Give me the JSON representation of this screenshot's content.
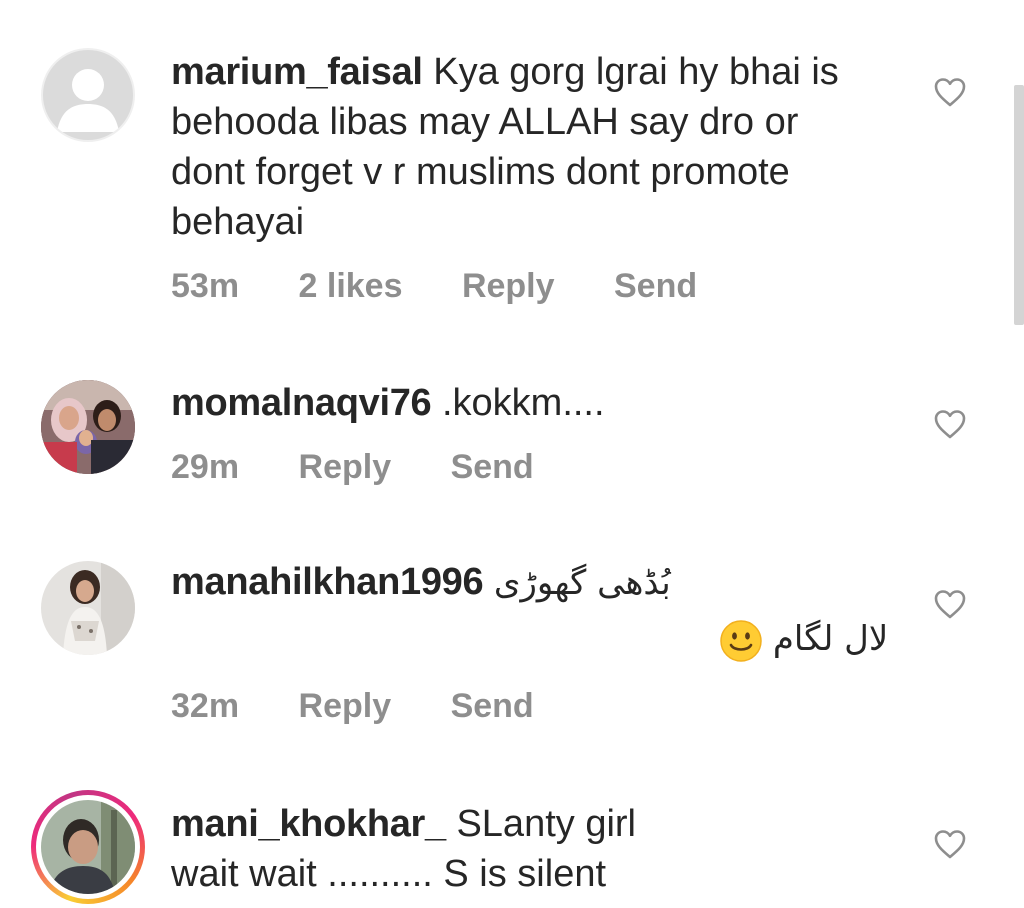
{
  "comments": [
    {
      "username": "marium_faisal",
      "text_lines": [
        "Kya gorg lgrai hy bhai is",
        "behooda libas may ALLAH say dro or",
        "dont forget v r muslims dont promote",
        "behayai"
      ],
      "time": "53m",
      "likes": "2 likes",
      "reply_label": "Reply",
      "send_label": "Send",
      "avatar": "default-avatar"
    },
    {
      "username": "momalnaqvi76",
      "text": ".kokkm....",
      "time": "29m",
      "reply_label": "Reply",
      "send_label": "Send",
      "avatar": "family-photo"
    },
    {
      "username": "manahilkhan1996",
      "text": "بُڈھی گھوڑی",
      "text_line2": "لال لگام",
      "emoji": "slightly-smiling-face",
      "time": "32m",
      "reply_label": "Reply",
      "send_label": "Send",
      "avatar": "woman-portrait"
    },
    {
      "username": "mani_khokhar_",
      "text_lines": [
        "SLanty girl",
        "wait wait .......... S is silent"
      ],
      "time": "",
      "reply_label": "",
      "send_label": "",
      "avatar": "man-portrait",
      "has_story_ring": true
    }
  ],
  "colors": {
    "text": "#262626",
    "meta": "#8e8e8e",
    "heart": "#8e8e8e",
    "background": "#ffffff"
  }
}
